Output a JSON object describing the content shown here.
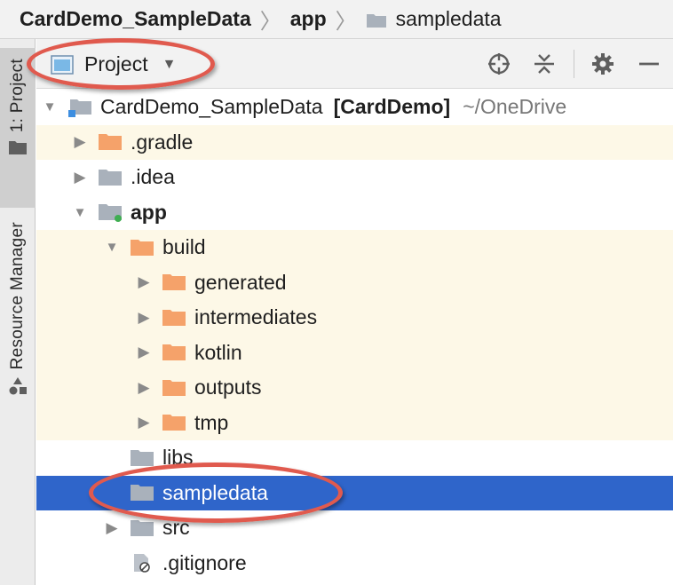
{
  "breadcrumb": {
    "items": [
      "CardDemo_SampleData",
      "app",
      "sampledata"
    ]
  },
  "tool_strip": {
    "project_tab": "1: Project",
    "resource_tab": "Resource Manager"
  },
  "toolbar": {
    "view_selector": "Project",
    "icons": [
      "locate-icon",
      "collapse-all-icon",
      "gear-icon",
      "minimize-icon"
    ]
  },
  "tree": {
    "root": {
      "label": "CardDemo_SampleData",
      "module": "[CardDemo]",
      "path": "~/OneDrive"
    },
    "rows": [
      {
        "label": ".gradle",
        "icon": "orange-folder-icon"
      },
      {
        "label": ".idea",
        "icon": "gray-folder-icon"
      },
      {
        "label": "app",
        "icon": "module-folder-icon"
      },
      {
        "label": "build",
        "icon": "orange-folder-icon"
      },
      {
        "label": "generated",
        "icon": "orange-folder-icon"
      },
      {
        "label": "intermediates",
        "icon": "orange-folder-icon"
      },
      {
        "label": "kotlin",
        "icon": "orange-folder-icon"
      },
      {
        "label": "outputs",
        "icon": "orange-folder-icon"
      },
      {
        "label": "tmp",
        "icon": "orange-folder-icon"
      },
      {
        "label": "libs",
        "icon": "gray-folder-icon"
      },
      {
        "label": "sampledata",
        "icon": "gray-folder-icon",
        "selected": true
      },
      {
        "label": "src",
        "icon": "gray-folder-icon"
      },
      {
        "label": ".gitignore",
        "icon": "ignore-file-icon"
      }
    ]
  },
  "colors": {
    "selection": "#2f65ca",
    "highlight_ellipse": "#e05a4e",
    "excluded_tint": "#fdf8e7",
    "orange_folder": "#f5a26a",
    "gray_folder": "#a9b1bb"
  }
}
